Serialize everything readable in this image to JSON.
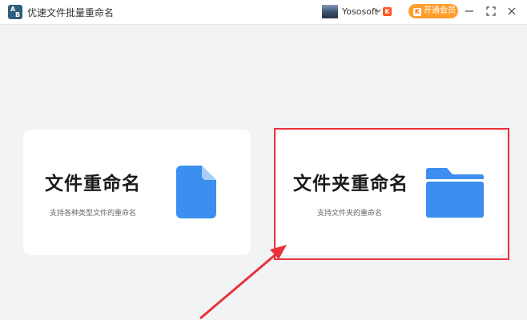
{
  "window": {
    "app_title": "优速文件批量重命名",
    "logo_letters": [
      "A",
      "B"
    ],
    "user": {
      "name": "Yososoft",
      "badge": "K"
    },
    "vip_button": {
      "icon_text": "K",
      "label": "开通会员"
    },
    "controls": [
      "minimize-icon",
      "maximize-icon",
      "close-icon"
    ]
  },
  "cards": [
    {
      "title": "文件重命名",
      "subtitle": "支持各种类型文件的重命名",
      "icon": "file-icon"
    },
    {
      "title": "文件夹重命名",
      "subtitle": "支持文件夹的重命名",
      "icon": "folder-icon"
    }
  ],
  "colors": {
    "background": "#f2f3f5",
    "icon_blue": "#3c8ef0",
    "vip_orange": "#ff9f2e",
    "annotation_red": "#e8333a"
  }
}
